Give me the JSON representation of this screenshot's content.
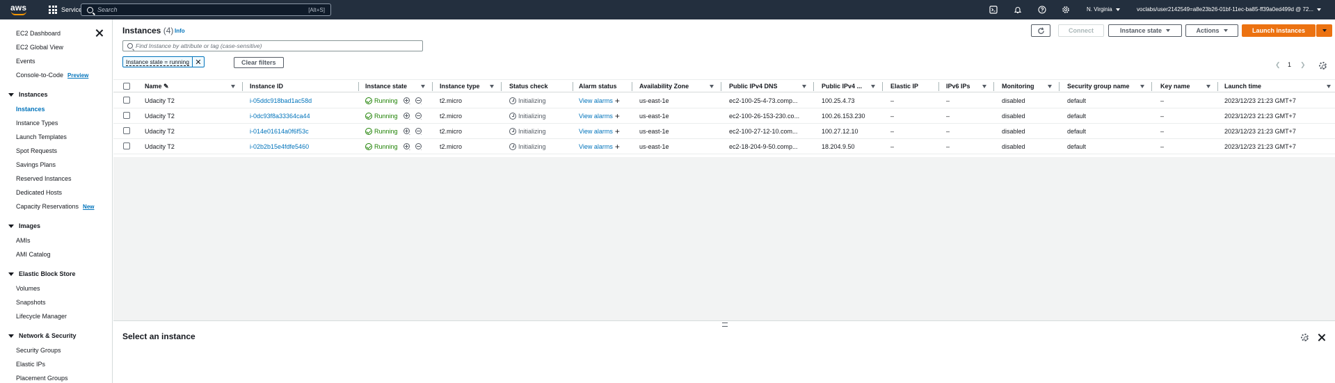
{
  "topnav": {
    "logo": "aws",
    "services": "Services",
    "search_placeholder": "Search",
    "search_shortcut": "[Alt+S]",
    "region": "N. Virginia",
    "account": "voclabs/user2142549=a8e23b26-01bf-11ec-ba85-ff39a0ed499d @ 72..."
  },
  "sidebar": {
    "top_items": [
      "EC2 Dashboard",
      "EC2 Global View",
      "Events",
      "Console-to-Code"
    ],
    "console_badge": "Preview",
    "instances_section": "Instances",
    "instances_items": [
      "Instances",
      "Instance Types",
      "Launch Templates",
      "Spot Requests",
      "Savings Plans",
      "Reserved Instances",
      "Dedicated Hosts",
      "Capacity Reservations"
    ],
    "capacity_badge": "New",
    "images_section": "Images",
    "images_items": [
      "AMIs",
      "AMI Catalog"
    ],
    "ebs_section": "Elastic Block Store",
    "ebs_items": [
      "Volumes",
      "Snapshots",
      "Lifecycle Manager"
    ],
    "network_section": "Network & Security",
    "network_items": [
      "Security Groups",
      "Elastic IPs",
      "Placement Groups"
    ]
  },
  "main": {
    "title": "Instances",
    "count": "(4)",
    "info": "Info",
    "connect": "Connect",
    "instance_state": "Instance state",
    "actions": "Actions",
    "launch": "Launch instances",
    "filter_placeholder": "Find Instance by attribute or tag (case-sensitive)",
    "token": "Instance state = running",
    "clear_filters": "Clear filters",
    "page": "1"
  },
  "table": {
    "columns": [
      "Name",
      "Instance ID",
      "Instance state",
      "Instance type",
      "Status check",
      "Alarm status",
      "Availability Zone",
      "Public IPv4 DNS",
      "Public IPv4 ...",
      "Elastic IP",
      "IPv6 IPs",
      "Monitoring",
      "Security group name",
      "Key name",
      "Launch time"
    ],
    "rows": [
      {
        "name": "Udacity T2",
        "id": "i-05ddc918bad1ac58d",
        "state": "Running",
        "type": "t2.micro",
        "status": "Initializing",
        "alarm": "View alarms",
        "az": "us-east-1e",
        "dns": "ec2-100-25-4-73.comp...",
        "ip": "100.25.4.73",
        "eip": "–",
        "ipv6": "–",
        "monitoring": "disabled",
        "sg": "default",
        "key": "–",
        "launch": "2023/12/23 21:23 GMT+7"
      },
      {
        "name": "Udacity T2",
        "id": "i-0dc93f8a33364ca44",
        "state": "Running",
        "type": "t2.micro",
        "status": "Initializing",
        "alarm": "View alarms",
        "az": "us-east-1e",
        "dns": "ec2-100-26-153-230.co...",
        "ip": "100.26.153.230",
        "eip": "–",
        "ipv6": "–",
        "monitoring": "disabled",
        "sg": "default",
        "key": "–",
        "launch": "2023/12/23 21:23 GMT+7"
      },
      {
        "name": "Udacity T2",
        "id": "i-014e01614a0f6f53c",
        "state": "Running",
        "type": "t2.micro",
        "status": "Initializing",
        "alarm": "View alarms",
        "az": "us-east-1e",
        "dns": "ec2-100-27-12-10.com...",
        "ip": "100.27.12.10",
        "eip": "–",
        "ipv6": "–",
        "monitoring": "disabled",
        "sg": "default",
        "key": "–",
        "launch": "2023/12/23 21:23 GMT+7"
      },
      {
        "name": "Udacity T2",
        "id": "i-02b2b15e4fdfe5460",
        "state": "Running",
        "type": "t2.micro",
        "status": "Initializing",
        "alarm": "View alarms",
        "az": "us-east-1e",
        "dns": "ec2-18-204-9-50.comp...",
        "ip": "18.204.9.50",
        "eip": "–",
        "ipv6": "–",
        "monitoring": "disabled",
        "sg": "default",
        "key": "–",
        "launch": "2023/12/23 21:23 GMT+7"
      }
    ]
  },
  "bottom": {
    "title": "Select an instance"
  },
  "colors": {
    "nav_bg": "#232f3e",
    "link": "#0073bb",
    "primary": "#ec7211",
    "running": "#1d8102"
  }
}
